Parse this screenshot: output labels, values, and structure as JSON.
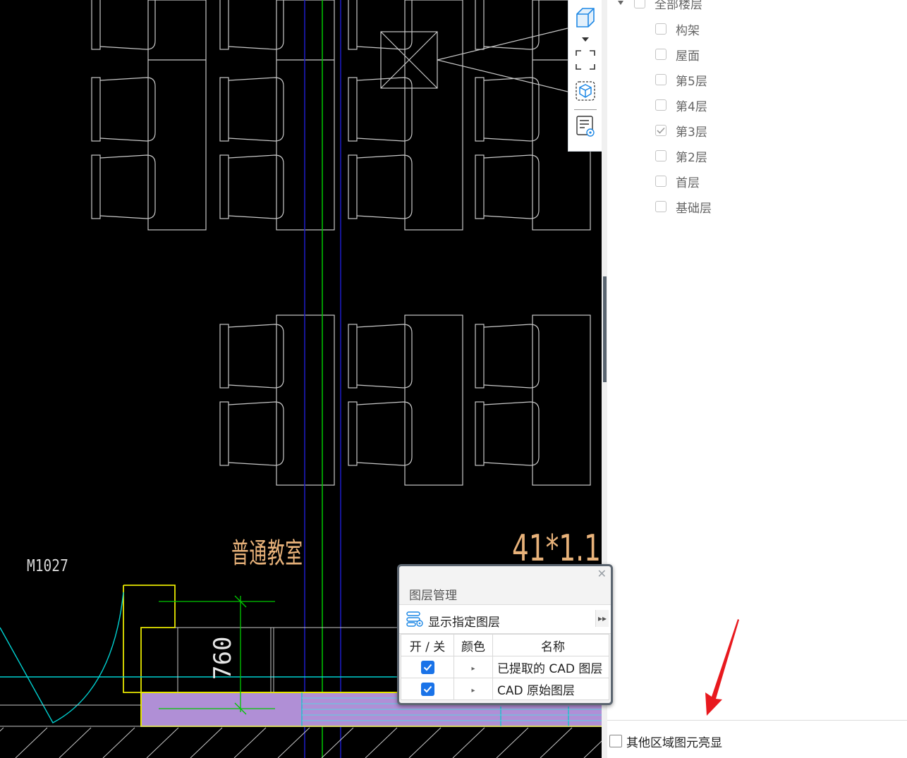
{
  "canvas": {
    "room_name": "普通教室",
    "door_label": "M1027",
    "dimension_label": "760",
    "size_text": "41*1.1"
  },
  "view_toolbar": {
    "buttons": [
      "3d-box-icon",
      "dropdown-arrow-icon",
      "fullscreen-icon",
      "3d-select-icon",
      "layer-view-icon"
    ]
  },
  "floor_tree": {
    "root_label": "全部楼层",
    "items": [
      {
        "label": "构架",
        "checked": false
      },
      {
        "label": "屋面",
        "checked": false
      },
      {
        "label": "第5层",
        "checked": false
      },
      {
        "label": "第4层",
        "checked": false
      },
      {
        "label": "第3层",
        "checked": true
      },
      {
        "label": "第2层",
        "checked": false
      },
      {
        "label": "首层",
        "checked": false
      },
      {
        "label": "基础层",
        "checked": false
      }
    ]
  },
  "highlight_option": {
    "label": "其他区域图元亮显",
    "checked": false
  },
  "layer_dialog": {
    "title": "图层管理",
    "show_layer_button": "显示指定图层",
    "columns": {
      "onoff": "开 / 关",
      "color": "颜色",
      "name": "名称"
    },
    "rows": [
      {
        "on": true,
        "name": "已提取的 CAD 图层"
      },
      {
        "on": true,
        "name": "CAD 原始图层"
      }
    ]
  },
  "colors": {
    "accent": "#1a73e8",
    "cad_text": "#e8b27a",
    "cad_lines": "#c8c8c8",
    "axis_green": "#00c800",
    "axis_blue": "#1e1ec8",
    "arrow_red": "#e8191e"
  }
}
